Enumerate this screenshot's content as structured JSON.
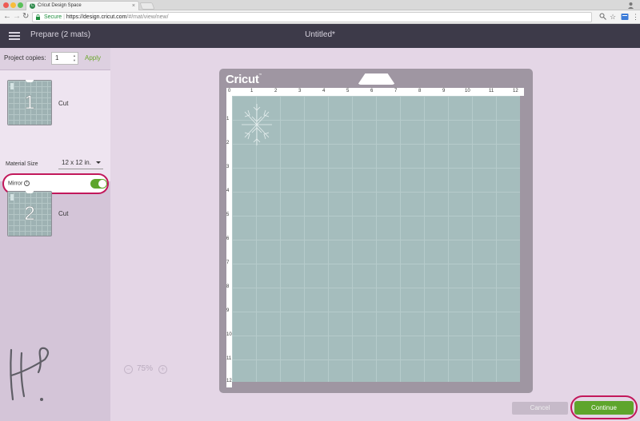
{
  "browser": {
    "tab_title": "Cricut Design Space",
    "tab_close": "×",
    "secure_label": "Secure",
    "url_host": "https://design.cricut.com",
    "url_path": "/#/mat/view/new/",
    "nav_back": "←",
    "nav_forward": "→",
    "nav_reload": "↻",
    "traffic_colors": [
      "#ee5c54",
      "#f8bd3b",
      "#5ac05a"
    ]
  },
  "header": {
    "prepare_label": "Prepare (2 mats)",
    "document_title": "Untitled*"
  },
  "sidebar": {
    "copies_label": "Project copies:",
    "copies_value": "1",
    "apply_label": "Apply",
    "mats": [
      {
        "number": "1",
        "label": "Cut"
      },
      {
        "number": "2",
        "label": "Cut"
      }
    ],
    "material_size_label": "Material Size",
    "material_size_value": "12 x 12 in.",
    "mirror_label": "Mirror",
    "mirror_on": true
  },
  "canvas": {
    "brand": "Cricut",
    "zoom_level": "75%",
    "zoom_out": "−",
    "zoom_in": "+",
    "ruler_top": [
      "0",
      "1",
      "2",
      "3",
      "4",
      "5",
      "6",
      "7",
      "8",
      "9",
      "10",
      "11",
      "12"
    ],
    "ruler_left": [
      "1",
      "2",
      "3",
      "4",
      "5",
      "6",
      "7",
      "8",
      "9",
      "10",
      "11",
      "12"
    ]
  },
  "actions": {
    "cancel_label": "Cancel",
    "continue_label": "Continue"
  },
  "colors": {
    "accent_green": "#5ea52c",
    "highlight_ring": "#c2185b",
    "mat_teal": "#a5bdbd",
    "header_dark": "#3d3a49"
  }
}
